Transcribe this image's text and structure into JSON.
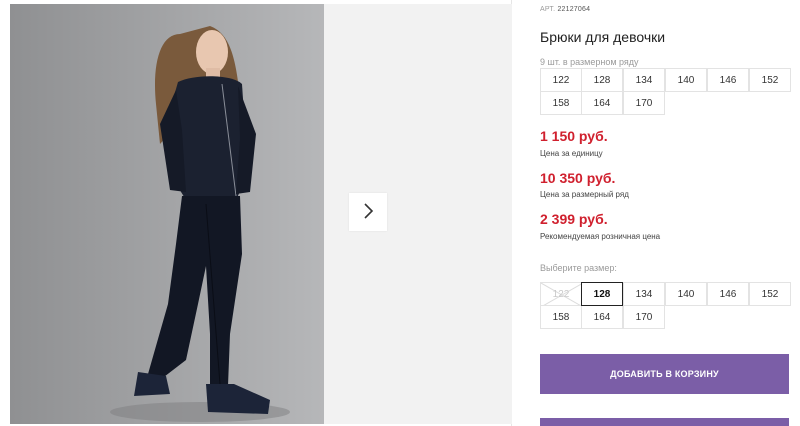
{
  "product": {
    "art_label": "АРТ.",
    "art_number": "22127064",
    "title": "Брюки для девочки",
    "pack_hint": "9 шт. в размерном ряду",
    "pack_sizes": [
      "122",
      "128",
      "134",
      "140",
      "146",
      "152",
      "158",
      "164",
      "170"
    ],
    "prices": [
      {
        "value": "1 150 руб.",
        "label": "Цена за единицу"
      },
      {
        "value": "10 350 руб.",
        "label": "Цена за размерный ряд"
      },
      {
        "value": "2 399 руб.",
        "label": "Рекомендуемая розничная цена"
      }
    ],
    "choose_label": "Выберите размер:",
    "size_options": [
      {
        "value": "122",
        "state": "unavailable"
      },
      {
        "value": "128",
        "state": "selected"
      },
      {
        "value": "134",
        "state": "available"
      },
      {
        "value": "140",
        "state": "available"
      },
      {
        "value": "146",
        "state": "available"
      },
      {
        "value": "152",
        "state": "available"
      },
      {
        "value": "158",
        "state": "available"
      },
      {
        "value": "164",
        "state": "available"
      },
      {
        "value": "170",
        "state": "available"
      }
    ],
    "add_to_cart": "ДОБАВИТЬ В КОРЗИНУ"
  },
  "gallery": {
    "next_icon": "chevron-right-icon"
  },
  "colors": {
    "accent": "#7b5ea7",
    "price": "#d0202e"
  }
}
